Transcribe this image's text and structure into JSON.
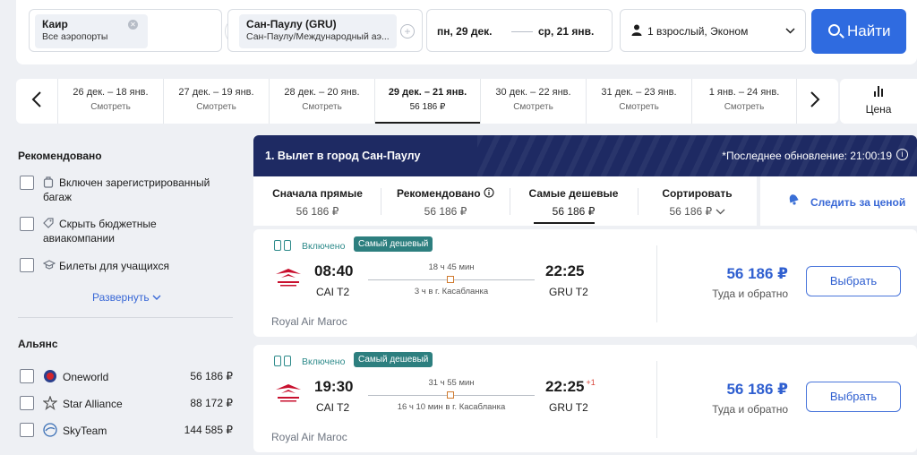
{
  "search": {
    "origin": {
      "city": "Каир",
      "sub": "Все аэропорты"
    },
    "destination": {
      "city": "Сан-Паулу (GRU)",
      "sub": "Сан-Паулу/Международный аэ..."
    },
    "depart_date": "пн, 29 дек.",
    "return_date": "ср, 21 янв.",
    "passengers": "1 взрослый, Эконом",
    "find_label": "Найти"
  },
  "carousel": {
    "days": [
      {
        "range": "26 дек. – 18 янв.",
        "price": "Смотреть"
      },
      {
        "range": "27 дек. – 19 янв.",
        "price": "Смотреть"
      },
      {
        "range": "28 дек. – 20 янв.",
        "price": "Смотреть"
      },
      {
        "range": "29 дек. – 21 янв.",
        "price": "56 186 ₽"
      },
      {
        "range": "30 дек. – 22 янв.",
        "price": "Смотреть"
      },
      {
        "range": "31 дек. – 23 янв.",
        "price": "Смотреть"
      },
      {
        "range": "1 янв. – 24 янв.",
        "price": "Смотреть"
      }
    ],
    "price_label": "Цена"
  },
  "sidebar": {
    "recommended_title": "Рекомендовано",
    "recommended": [
      {
        "label": "Включен зарегистрированный багаж",
        "icon": "baggage-icon"
      },
      {
        "label": "Скрыть бюджетные авиакомпании",
        "icon": "tag-icon"
      },
      {
        "label": "Билеты для учащихся",
        "icon": "graduation-cap-icon"
      }
    ],
    "expand_label": "Развернуть",
    "alliance_title": "Альянс",
    "alliances": [
      {
        "name": "Oneworld",
        "price": "56 186 ₽"
      },
      {
        "name": "Star Alliance",
        "price": "88 172 ₽"
      },
      {
        "name": "SkyTeam",
        "price": "144 585 ₽"
      }
    ]
  },
  "results": {
    "title": "1. Вылет в город Сан-Паулу",
    "updated": "*Последнее обновление: 21:00:19",
    "sort": [
      {
        "label": "Сначала прямые",
        "value": "56 186 ₽"
      },
      {
        "label": "Рекомендовано",
        "value": "56 186 ₽"
      },
      {
        "label": "Самые дешевые",
        "value": "56 186 ₽"
      },
      {
        "label": "Сортировать",
        "value": "56 186 ₽"
      }
    ],
    "watch_label": "Следить за ценой"
  },
  "flights": [
    {
      "included": "Включено",
      "badge": "Самый дешевый",
      "dep_time": "08:40",
      "dep_apt": "CAI T2",
      "arr_time": "22:25",
      "arr_plus": "",
      "arr_apt": "GRU T2",
      "duration": "18 ч 45 мин",
      "stop": "3 ч в г. Касабланка",
      "airline": "Royal Air Maroc",
      "price": "56 186 ₽",
      "trip": "Туда и обратно",
      "select": "Выбрать"
    },
    {
      "included": "Включено",
      "badge": "Самый дешевый",
      "dep_time": "19:30",
      "dep_apt": "CAI T2",
      "arr_time": "22:25",
      "arr_plus": "+1",
      "arr_apt": "GRU T2",
      "duration": "31 ч 55 мин",
      "stop": "16 ч 10 мин в г. Касабланка",
      "airline": "Royal Air Maroc",
      "price": "56 186 ₽",
      "trip": "Туда и обратно",
      "select": "Выбрать"
    }
  ]
}
